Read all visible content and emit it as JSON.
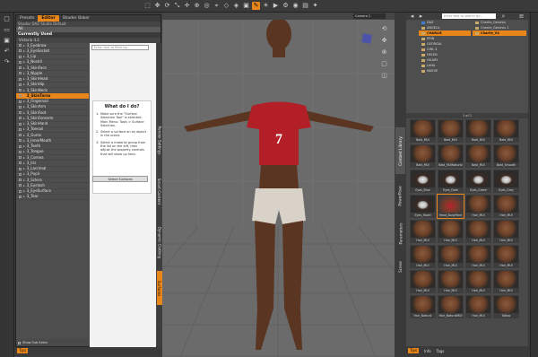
{
  "left_panel": {
    "tabs": [
      "Presets",
      "Editor",
      "Shader Baker"
    ],
    "active_tab": "Editor",
    "crumb": "Shader DAZ Studio Default",
    "filter_all": "All",
    "filter_used": "Currently Used",
    "tree_root": "Victoria 4.2",
    "surfaces": [
      "3_Eyebrow",
      "3_EyeSocket",
      "3_Lip",
      "3_Nostril",
      "3_SkinFace",
      "3_Nipple",
      "3_SkinHead",
      "3_SkinHip",
      "3_SkinNeck",
      "3_SkinTorso",
      "3_Fingernail",
      "3_SkinArm",
      "3_SkinFoot",
      "3_SkinForearm",
      "3_SkinHand",
      "3_Toenail",
      "3_Gums",
      "3_InnerMouth",
      "3_Teeth",
      "3_Tongue",
      "3_Cornea",
      "3_Iris",
      "3_Lacrimal",
      "3_Pupil",
      "3_Sclera",
      "3_Eyelash",
      "3_EyeSurface",
      "3_Tear"
    ],
    "selected_surface": "3_SkinTorso",
    "search_placeholder": "Enter text to filter by...",
    "help": {
      "title": "What do I do?",
      "steps": [
        "Make sure the \"Surface Selection Tool\" is selected. Main Menu: Tools > Surface Selection.",
        "Select a surface on an object in the scene.",
        "Select a material group from the list on the left, then adjust the property controls that will show up here."
      ],
      "step_numbers": [
        "1.",
        "2.",
        "3."
      ],
      "button": "Select Surfaces"
    },
    "show_sub_items": "Show Sub Items",
    "vertical_tabs": [
      "Render Settings",
      "Smart Content",
      "Dynamic Clothing",
      "Surfaces"
    ],
    "active_vertical_tab": "Surfaces",
    "tips": "Tips"
  },
  "viewport": {
    "camera": "Camera 1",
    "shirt_number": "7"
  },
  "right_panel": {
    "vertical_tabs": [
      "Content Library",
      "PowerPose",
      "Parameters",
      "Scene"
    ],
    "active_vertical_tab": "Content Library",
    "search_placeholder": "Enter text to search by...",
    "folder_col1": [
      "DAZ",
      "ANGELA",
      "CHARLIE",
      "ERIN",
      "GEORGIA",
      "GIRL 4",
      "HELEN",
      "HILARY",
      "LUNA",
      "MAEVE"
    ],
    "folder_col1_selected": "CHARLIE",
    "folder_col2": [
      "Charlie_Genesis",
      "Charlie_Genesis 1",
      "Charlie_V4"
    ],
    "folder_col2_selected": "Charlie_V4",
    "pager": "1 of 2",
    "tiles": [
      "Bald_MUI",
      "Bald_MUI",
      "Bald_MUI",
      "Bald_MUI",
      "Bald_MUI",
      "Bald_MUINatural",
      "Bald_MUI",
      "Bald_Smooth",
      "Eyes_Blue",
      "Eyes_Dark",
      "Eyes_Green",
      "Eyes_Grey",
      "Eyes_Hazel",
      "Head_BodyPaint",
      "Hair_MUI",
      "Hair_MUI",
      "Hair_MUI",
      "Hair_MUI",
      "Hair_MUI",
      "Hair_MUI",
      "Hair_MUI",
      "Hair_MUI",
      "Hair_MUI",
      "Hair_MUI",
      "Hair_MUI",
      "Hair_MUI",
      "Hair_MUI",
      "Hair_MUI",
      "Hair_Natural",
      "Hair_NaturalMUI",
      "Hair_MUI",
      "Tattoo"
    ],
    "selected_tile_index": 13,
    "footer": [
      "Tips",
      "Info",
      "Tags"
    ]
  }
}
